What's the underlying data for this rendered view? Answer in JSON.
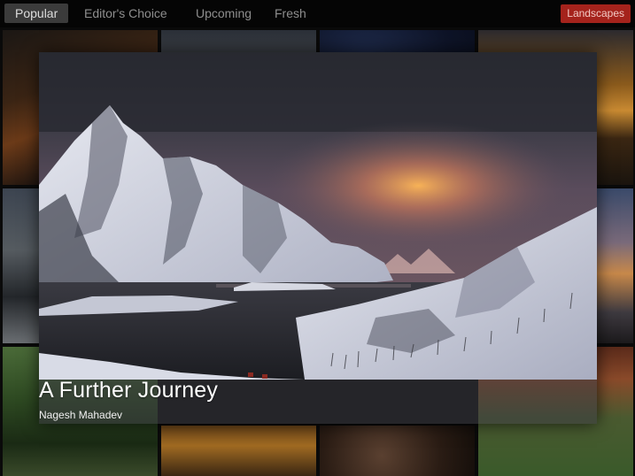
{
  "nav": {
    "tabs": [
      {
        "label": "Popular",
        "active": true
      },
      {
        "label": "Editor's Choice",
        "active": false
      },
      {
        "label": "Upcoming",
        "active": false
      },
      {
        "label": "Fresh",
        "active": false
      }
    ],
    "category_label": "Landscapes"
  },
  "featured": {
    "title": "A Further Journey",
    "author": "Nagesh Mahadev"
  },
  "colors": {
    "accent": "#a5231c",
    "active_tab_bg": "#3b3b3b",
    "topbar_bg": "#050505"
  }
}
